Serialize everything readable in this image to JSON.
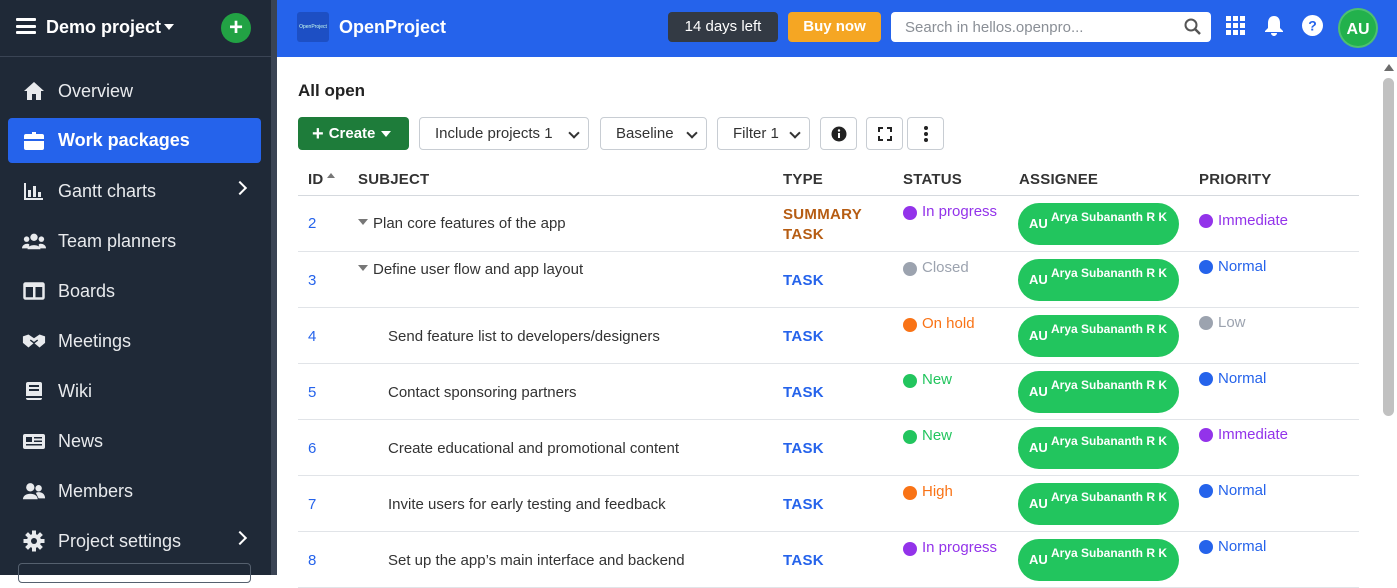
{
  "sidebar": {
    "project_name": "Demo project",
    "items": [
      {
        "label": "Overview",
        "icon": "home-icon"
      },
      {
        "label": "Work packages",
        "icon": "work-packages-icon",
        "active": true
      },
      {
        "label": "Gantt charts",
        "icon": "gantt-icon",
        "has_children": true
      },
      {
        "label": "Team planners",
        "icon": "team-planner-icon"
      },
      {
        "label": "Boards",
        "icon": "boards-icon"
      },
      {
        "label": "Meetings",
        "icon": "meetings-icon"
      },
      {
        "label": "Wiki",
        "icon": "wiki-icon"
      },
      {
        "label": "News",
        "icon": "news-icon"
      },
      {
        "label": "Members",
        "icon": "members-icon"
      },
      {
        "label": "Project settings",
        "icon": "settings-icon",
        "has_children": true
      }
    ]
  },
  "header": {
    "app_title": "OpenProject",
    "logo_text": "OpenProject",
    "trial_label": "14 days left",
    "buy_label": "Buy now",
    "search_placeholder": "Search in hellos.openpro...",
    "avatar_initials": "AU"
  },
  "main": {
    "title": "All open",
    "toolbar": {
      "create_label": "Create",
      "include_projects_label": "Include projects 1",
      "baseline_label": "Baseline",
      "filter_label": "Filter 1"
    },
    "columns": {
      "id": "ID",
      "subject": "SUBJECT",
      "type": "TYPE",
      "status": "STATUS",
      "assignee": "ASSIGNEE",
      "priority": "PRIORITY"
    },
    "rows": [
      {
        "id": "2",
        "subject": "Plan core features of the app",
        "type": "SUMMARY TASK",
        "status": "In progress",
        "assignee_initials": "AU",
        "assignee": "Arya Subananth R K",
        "priority": "Immediate"
      },
      {
        "id": "3",
        "subject": "Define user flow and app layout",
        "type": "TASK",
        "status": "Closed",
        "assignee_initials": "AU",
        "assignee": "Arya Subananth R K",
        "priority": "Normal"
      },
      {
        "id": "4",
        "subject": "Send feature list to developers/designers",
        "type": "TASK",
        "status": "On hold",
        "assignee_initials": "AU",
        "assignee": "Arya Subananth R K",
        "priority": "Low"
      },
      {
        "id": "5",
        "subject": "Contact sponsoring partners",
        "type": "TASK",
        "status": "New",
        "assignee_initials": "AU",
        "assignee": "Arya Subananth R K",
        "priority": "Normal"
      },
      {
        "id": "6",
        "subject": "Create educational and promotional content",
        "type": "TASK",
        "status": "New",
        "assignee_initials": "AU",
        "assignee": "Arya Subananth R K",
        "priority": "Immediate"
      },
      {
        "id": "7",
        "subject": "Invite users for early testing and feedback",
        "type": "TASK",
        "status": "High",
        "assignee_initials": "AU",
        "assignee": "Arya Subananth R K",
        "priority": "Normal"
      },
      {
        "id": "8",
        "subject": "Set up the app’s main interface and backend",
        "type": "TASK",
        "status": "In progress",
        "assignee_initials": "AU",
        "assignee": "Arya Subananth R K",
        "priority": "Normal"
      }
    ]
  },
  "colors": {
    "brand_blue": "#2563eb",
    "sidebar_bg": "#1f2937",
    "create_green": "#1e7c3a",
    "assignee_green": "#22c55e",
    "buy_orange": "#f5a623",
    "status_in_progress": "#9333ea",
    "status_closed": "#9ca3af",
    "status_on_hold": "#f97316",
    "status_new": "#22c55e",
    "status_high": "#f97316",
    "prio_immediate": "#9333ea",
    "prio_normal": "#2563eb",
    "prio_low": "#9ca3af"
  }
}
